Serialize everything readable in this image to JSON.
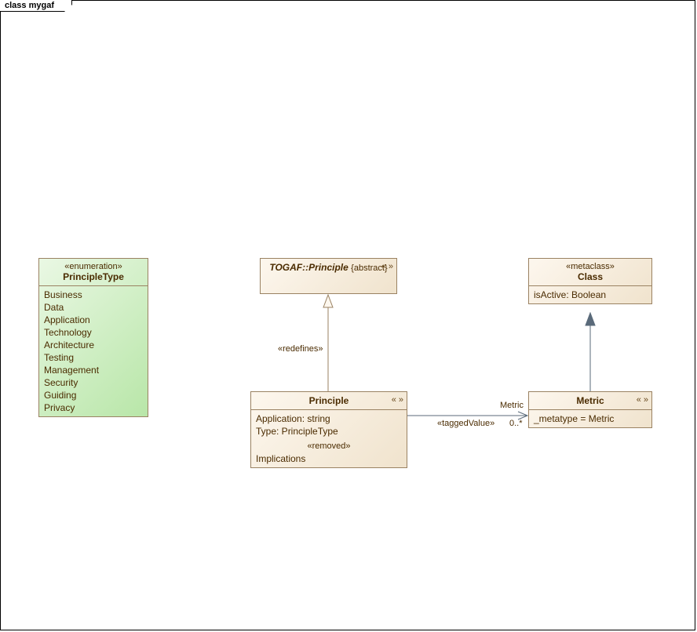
{
  "frame_title": "class mygaf",
  "enum": {
    "stereo": "«enumeration»",
    "title": "PrincipleType",
    "literals": [
      "Business",
      "Data",
      "Application",
      "Technology",
      "Architecture",
      "Testing",
      "Management",
      "Security",
      "Guiding",
      "Privacy"
    ]
  },
  "togaf_principle": {
    "title": "TOGAF::Principle",
    "constraint": "{abstract}",
    "icon": "« »"
  },
  "metaclass": {
    "stereo": "«metaclass»",
    "title": "Class",
    "attr": "isActive: Boolean"
  },
  "principle": {
    "title": "Principle",
    "icon": "« »",
    "attrs": [
      "Application: string",
      "Type: PrincipleType"
    ],
    "removed_stereo": "«removed»",
    "removed_attr": "Implications"
  },
  "metric": {
    "title": "Metric",
    "icon": "« »",
    "attr": "_metatype = Metric"
  },
  "edges": {
    "redefines": "«redefines»",
    "taggedValue": "«taggedValue»",
    "metric_role": "Metric",
    "metric_mult": "0..*"
  },
  "chart_data": {
    "type": "uml-class-diagram",
    "name": "mygaf",
    "classes": [
      {
        "id": "PrincipleType",
        "kind": "enumeration",
        "literals": [
          "Business",
          "Data",
          "Application",
          "Technology",
          "Architecture",
          "Testing",
          "Management",
          "Security",
          "Guiding",
          "Privacy"
        ]
      },
      {
        "id": "TOGAF::Principle",
        "kind": "stereotype",
        "abstract": true
      },
      {
        "id": "Class",
        "kind": "metaclass",
        "attributes": [
          "isActive: Boolean"
        ]
      },
      {
        "id": "Principle",
        "kind": "stereotype",
        "attributes": [
          "Application: string",
          "Type: PrincipleType"
        ],
        "removed": [
          "Implications"
        ]
      },
      {
        "id": "Metric",
        "kind": "stereotype",
        "attributes": [
          "_metatype = Metric"
        ]
      }
    ],
    "relations": [
      {
        "from": "Principle",
        "to": "TOGAF::Principle",
        "type": "generalization",
        "stereotype": "redefines"
      },
      {
        "from": "Metric",
        "to": "Class",
        "type": "extension"
      },
      {
        "from": "Principle",
        "to": "Metric",
        "type": "association",
        "stereotype": "taggedValue",
        "end": {
          "role": "Metric",
          "multiplicity": "0..*",
          "navigable": true
        }
      }
    ]
  }
}
